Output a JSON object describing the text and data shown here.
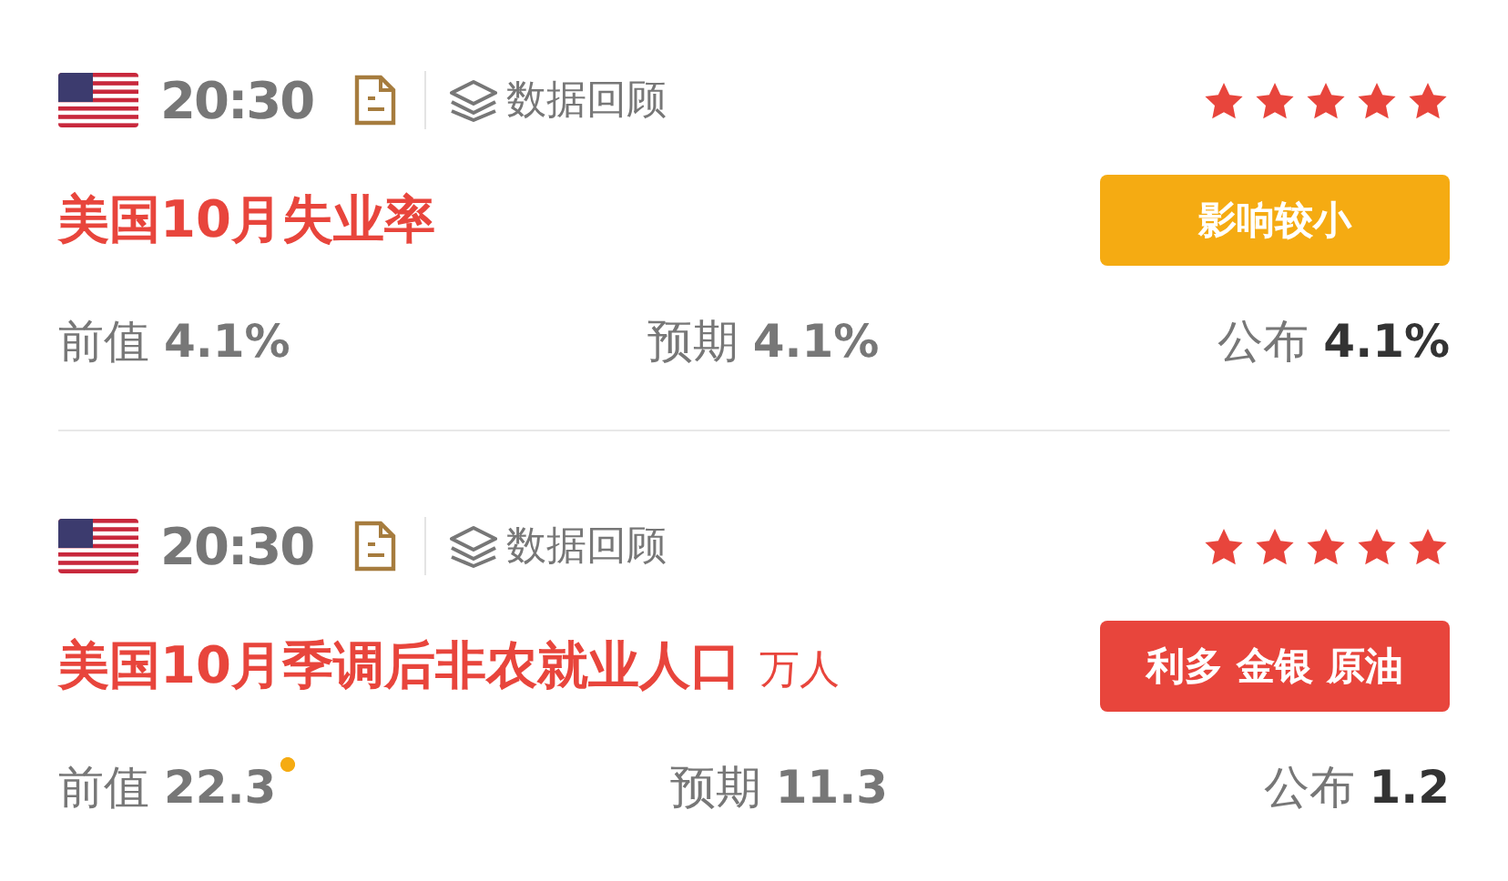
{
  "events": [
    {
      "time": "20:30",
      "review": "数据回顾",
      "stars": 5,
      "title": "美国10月失业率",
      "badge": {
        "kind": "minor",
        "label": "影响较小"
      },
      "previous": {
        "label": "前值",
        "value": "4.1%",
        "revised": false
      },
      "forecast": {
        "label": "预期",
        "value": "4.1%"
      },
      "actual": {
        "label": "公布",
        "value": "4.1%"
      }
    },
    {
      "time": "20:30",
      "review": "数据回顾",
      "stars": 5,
      "title": "美国10月季调后非农就业人口",
      "unit": "万人",
      "badge": {
        "kind": "bullish",
        "label": "利多 金银 原油"
      },
      "previous": {
        "label": "前值",
        "value": "22.3",
        "revised": true
      },
      "forecast": {
        "label": "预期",
        "value": "11.3"
      },
      "actual": {
        "label": "公布",
        "value": "1.2"
      }
    }
  ]
}
